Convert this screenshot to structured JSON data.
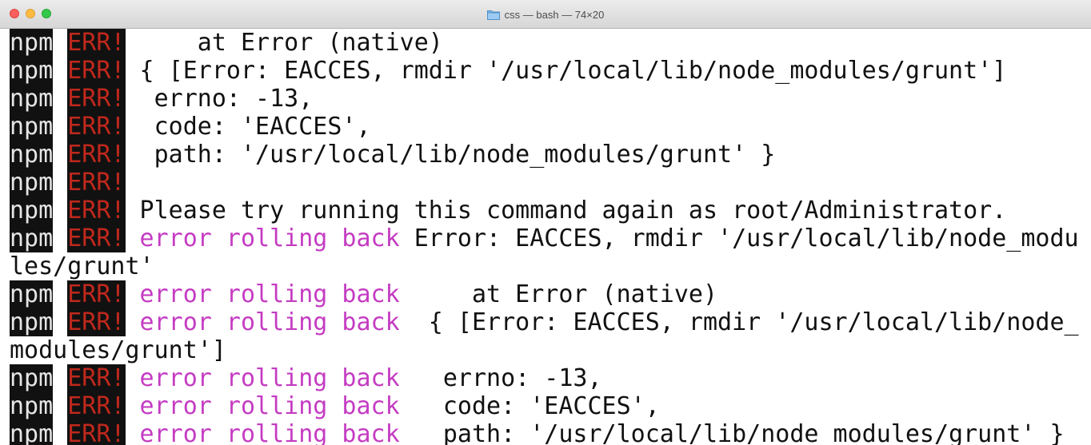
{
  "window": {
    "title": "css — bash — 74×20"
  },
  "terminal": {
    "lines": [
      {
        "prefix": "npm",
        "tag": "ERR!",
        "context": "",
        "text": "     at Error (native)"
      },
      {
        "prefix": "npm",
        "tag": "ERR!",
        "context": "",
        "text": " { [Error: EACCES, rmdir '/usr/local/lib/node_modules/grunt']"
      },
      {
        "prefix": "npm",
        "tag": "ERR!",
        "context": "",
        "text": "  errno: -13,"
      },
      {
        "prefix": "npm",
        "tag": "ERR!",
        "context": "",
        "text": "  code: 'EACCES',"
      },
      {
        "prefix": "npm",
        "tag": "ERR!",
        "context": "",
        "text": "  path: '/usr/local/lib/node_modules/grunt' }"
      },
      {
        "prefix": "npm",
        "tag": "ERR!",
        "context": "",
        "text": ""
      },
      {
        "prefix": "npm",
        "tag": "ERR!",
        "context": "",
        "text": " Please try running this command again as root/Administrator."
      },
      {
        "prefix": "npm",
        "tag": "ERR!",
        "context": " error rolling back",
        "text": " Error: EACCES, rmdir '/usr/local/lib/node_modu"
      },
      {
        "prefix": "",
        "tag": "",
        "context": "",
        "text": "les/grunt'"
      },
      {
        "prefix": "npm",
        "tag": "ERR!",
        "context": " error rolling back",
        "text": "     at Error (native)"
      },
      {
        "prefix": "npm",
        "tag": "ERR!",
        "context": " error rolling back",
        "text": "  { [Error: EACCES, rmdir '/usr/local/lib/node_"
      },
      {
        "prefix": "",
        "tag": "",
        "context": "",
        "text": "modules/grunt']"
      },
      {
        "prefix": "npm",
        "tag": "ERR!",
        "context": " error rolling back",
        "text": "   errno: -13,"
      },
      {
        "prefix": "npm",
        "tag": "ERR!",
        "context": " error rolling back",
        "text": "   code: 'EACCES',"
      },
      {
        "prefix": "npm",
        "tag": "ERR!",
        "context": " error rolling back",
        "text": "   path: '/usr/local/lib/node_modules/grunt' }"
      }
    ]
  },
  "colors": {
    "background": "#ffffff",
    "text": "#111111",
    "npm_label_bg": "#111111",
    "npm_label_fg": "#e6e6e6",
    "err_label_fg": "#c0281c",
    "context_text": "#c43cc2"
  },
  "icons": {
    "title_icon": "folder-icon"
  }
}
